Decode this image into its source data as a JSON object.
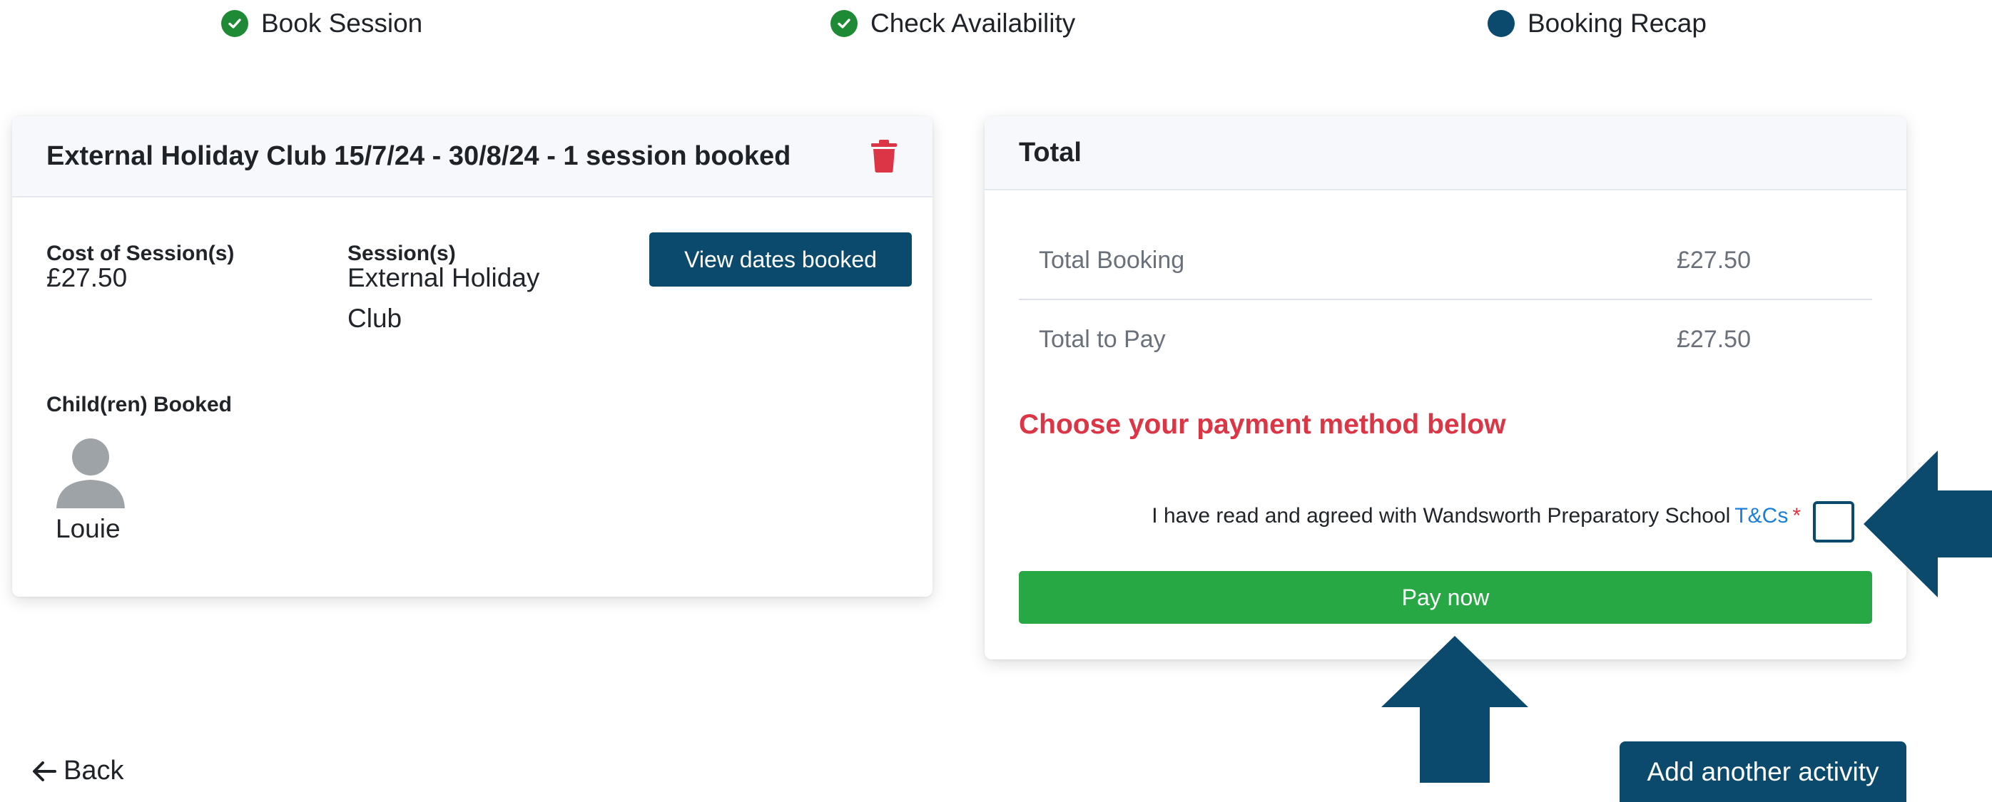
{
  "stepper": {
    "steps": [
      {
        "label": "Book Session",
        "state": "complete"
      },
      {
        "label": "Check Availability",
        "state": "complete"
      },
      {
        "label": "Booking Recap",
        "state": "current"
      }
    ]
  },
  "booking": {
    "title": "External Holiday Club 15/7/24 - 30/8/24 - 1 session booked",
    "cost_label": "Cost of Session(s)",
    "cost_value": "£27.50",
    "sessions_label": "Session(s)",
    "sessions_value_line1": "External Holiday",
    "sessions_value_line2": "Club",
    "view_dates_label": "View dates booked",
    "children_label": "Child(ren) Booked",
    "child_name": "Louie",
    "delete_icon": "trash-icon"
  },
  "total": {
    "title": "Total",
    "rows": [
      {
        "label": "Total Booking",
        "value": "£27.50"
      },
      {
        "label": "Total to Pay",
        "value": "£27.50"
      }
    ],
    "payment_heading": "Choose your payment method below",
    "terms_text": "I have read and agreed with Wandsworth Preparatory School",
    "terms_link": "T&Cs",
    "terms_required": "*",
    "terms_checked": false,
    "pay_label": "Pay now"
  },
  "footer": {
    "back_label": "Back",
    "add_activity_label": "Add another activity"
  },
  "colors": {
    "primary": "#0b4a6c",
    "success": "#28a745",
    "danger": "#dc3545",
    "link": "#1a7fd6"
  }
}
